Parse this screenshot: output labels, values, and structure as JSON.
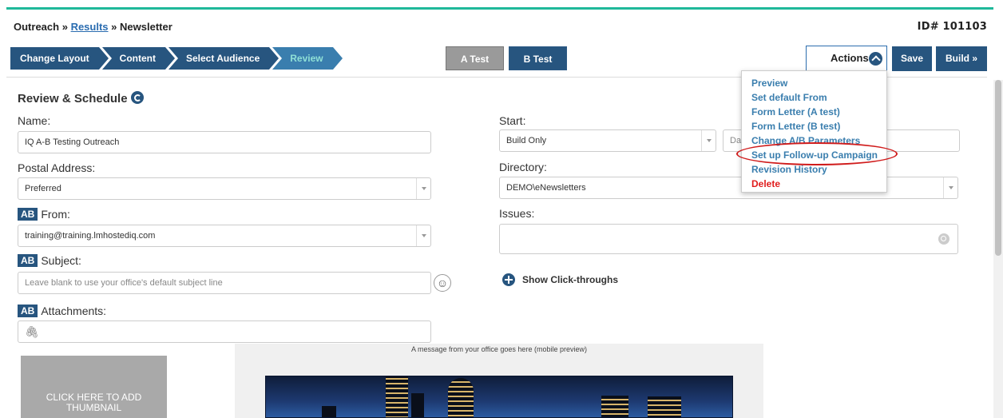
{
  "breadcrumb": {
    "root": "Outreach",
    "sep": "»",
    "link": "Results",
    "current": "Newsletter"
  },
  "id_label": "ID# 101103",
  "steps": [
    {
      "label": "Change Layout"
    },
    {
      "label": "Content"
    },
    {
      "label": "Select Audience"
    },
    {
      "label": "Review"
    }
  ],
  "ab_tabs": {
    "a": "A Test",
    "b": "B Test"
  },
  "toolbar": {
    "actions": "Actions",
    "save": "Save",
    "build": "Build »"
  },
  "actions_menu": [
    "Preview",
    "Set default From",
    "Form Letter (A test)",
    "Form Letter (B test)",
    "Change A/B Parameters",
    "Set up Follow-up Campaign",
    "Revision History",
    "Delete"
  ],
  "section": {
    "title": "Review & Schedule"
  },
  "form": {
    "name_label": "Name:",
    "name_value": "IQ A-B Testing Outreach",
    "postal_label": "Postal Address:",
    "postal_value": "Preferred",
    "ab_badge": "AB",
    "from_label": "From:",
    "from_value": "training@training.lmhostediq.com",
    "subject_label": "Subject:",
    "subject_placeholder": "Leave blank to use your office's default subject line",
    "attachments_label": "Attachments:",
    "start_label": "Start:",
    "start_value": "Build Only",
    "date_placeholder": "Dat",
    "directory_label": "Directory:",
    "directory_value": "DEMO\\eNewsletters",
    "issues_label": "Issues:",
    "show_click": "Show Click-throughs"
  },
  "thumbnail": {
    "line1": "CLICK HERE TO ADD",
    "line2": "THUMBNAIL"
  },
  "preview": {
    "message": "A message from your office goes here (mobile preview)"
  },
  "colors": {
    "accent": "#1fb89a",
    "primary": "#27557f",
    "link": "#3a7eae",
    "danger": "#e01c1c"
  }
}
